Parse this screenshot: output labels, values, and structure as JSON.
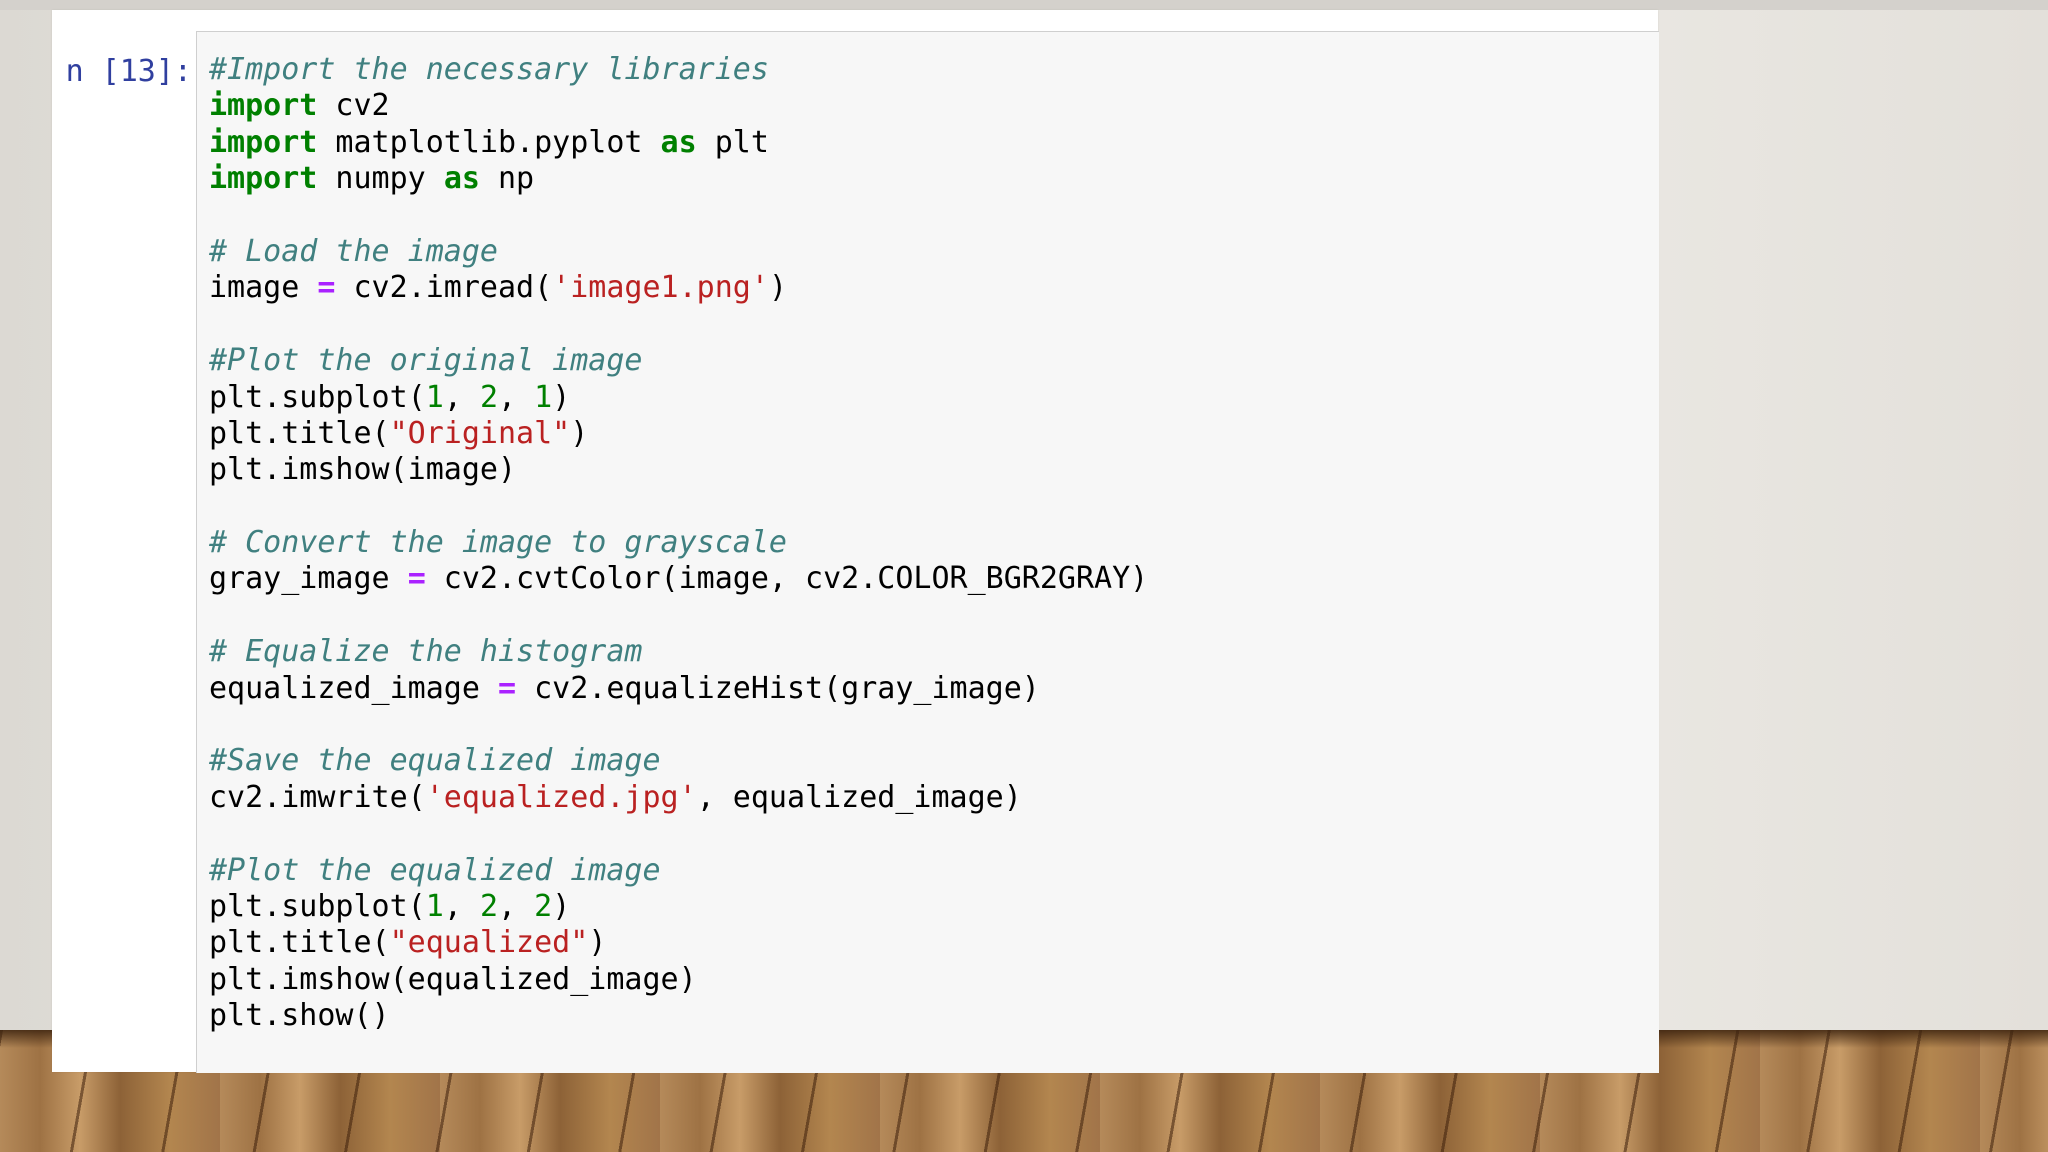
{
  "cell": {
    "prompt": "n [13]:",
    "lines": [
      [
        {
          "t": "#Import the necessary libraries",
          "c": "cm"
        }
      ],
      [
        {
          "t": "import",
          "c": "kw"
        },
        {
          "t": " cv2",
          "c": ""
        }
      ],
      [
        {
          "t": "import",
          "c": "kw"
        },
        {
          "t": " matplotlib.pyplot ",
          "c": ""
        },
        {
          "t": "as",
          "c": "kw"
        },
        {
          "t": " plt",
          "c": ""
        }
      ],
      [
        {
          "t": "import",
          "c": "kw"
        },
        {
          "t": " numpy ",
          "c": ""
        },
        {
          "t": "as",
          "c": "kw"
        },
        {
          "t": " np",
          "c": ""
        }
      ],
      [],
      [
        {
          "t": "# Load the image",
          "c": "cm"
        }
      ],
      [
        {
          "t": "image ",
          "c": ""
        },
        {
          "t": "=",
          "c": "op"
        },
        {
          "t": " cv2.imread(",
          "c": ""
        },
        {
          "t": "'image1.png'",
          "c": "st"
        },
        {
          "t": ")",
          "c": ""
        }
      ],
      [],
      [
        {
          "t": "#Plot the original image",
          "c": "cm"
        }
      ],
      [
        {
          "t": "plt.subplot(",
          "c": ""
        },
        {
          "t": "1",
          "c": "nm"
        },
        {
          "t": ", ",
          "c": ""
        },
        {
          "t": "2",
          "c": "nm"
        },
        {
          "t": ", ",
          "c": ""
        },
        {
          "t": "1",
          "c": "nm"
        },
        {
          "t": ")",
          "c": ""
        }
      ],
      [
        {
          "t": "plt.title(",
          "c": ""
        },
        {
          "t": "\"Original\"",
          "c": "st"
        },
        {
          "t": ")",
          "c": ""
        }
      ],
      [
        {
          "t": "plt.imshow(image)",
          "c": ""
        }
      ],
      [],
      [
        {
          "t": "# Convert the image to grayscale",
          "c": "cm"
        }
      ],
      [
        {
          "t": "gray_image ",
          "c": ""
        },
        {
          "t": "=",
          "c": "op"
        },
        {
          "t": " cv2.cvtColor(image, cv2.COLOR_BGR2GRAY)",
          "c": ""
        }
      ],
      [],
      [
        {
          "t": "# Equalize the histogram",
          "c": "cm"
        }
      ],
      [
        {
          "t": "equalized_image ",
          "c": ""
        },
        {
          "t": "=",
          "c": "op"
        },
        {
          "t": " cv2.equalizeHist(gray_image)",
          "c": ""
        }
      ],
      [],
      [
        {
          "t": "#Save the equalized image",
          "c": "cm"
        }
      ],
      [
        {
          "t": "cv2.imwrite(",
          "c": ""
        },
        {
          "t": "'equalized.jpg'",
          "c": "st"
        },
        {
          "t": ", equalized_image)",
          "c": ""
        }
      ],
      [],
      [
        {
          "t": "#Plot the equalized image",
          "c": "cm"
        }
      ],
      [
        {
          "t": "plt.subplot(",
          "c": ""
        },
        {
          "t": "1",
          "c": "nm"
        },
        {
          "t": ", ",
          "c": ""
        },
        {
          "t": "2",
          "c": "nm"
        },
        {
          "t": ", ",
          "c": ""
        },
        {
          "t": "2",
          "c": "nm"
        },
        {
          "t": ")",
          "c": ""
        }
      ],
      [
        {
          "t": "plt.title(",
          "c": ""
        },
        {
          "t": "\"equalized\"",
          "c": "st"
        },
        {
          "t": ")",
          "c": ""
        }
      ],
      [
        {
          "t": "plt.imshow(equalized_image)",
          "c": ""
        }
      ],
      [
        {
          "t": "plt.show()",
          "c": ""
        }
      ]
    ]
  },
  "colors": {
    "comment": "#408080",
    "keyword": "#008000",
    "string": "#ba2121",
    "number": "#008000",
    "operator": "#aa22ff",
    "prompt": "#303f9f",
    "cell_background": "#f7f7f7"
  }
}
